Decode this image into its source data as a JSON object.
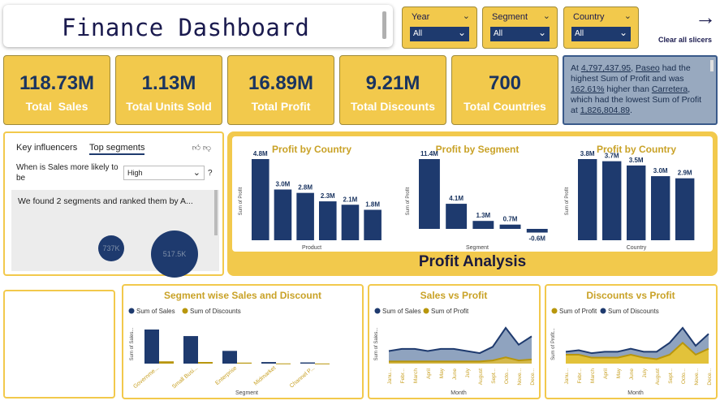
{
  "header": {
    "title": "Finance Dashboard"
  },
  "slicers": [
    {
      "label": "Year",
      "value": "All"
    },
    {
      "label": "Segment",
      "value": "All"
    },
    {
      "label": "Country",
      "value": "All"
    }
  ],
  "clear_slicers": {
    "label": "Clear all slicers",
    "icon": "arrow-right-icon"
  },
  "kpis": [
    {
      "value": "118.73M",
      "label": "Total  Sales"
    },
    {
      "value": "1.13M",
      "label": "Total Units Sold"
    },
    {
      "value": "16.89M",
      "label": "Total Profit"
    },
    {
      "value": "9.21M",
      "label": "Total Discounts"
    },
    {
      "value": "700",
      "label": "Total Countries"
    }
  ],
  "narrative": {
    "p1": "At ",
    "amount": "4,797,437.95",
    "p2": ", ",
    "top": "Paseo",
    "p3": " had the highest Sum of Profit and was ",
    "pct": "162.61%",
    "p4": " higher than ",
    "low": "Carretera",
    "p5": ", which had the lowest Sum of Profit at ",
    "low_amount": "1,826,804.89",
    "p6": "."
  },
  "key_influencers": {
    "tab1": "Key influencers",
    "tab2": "Top segments",
    "question": "When is Sales more likely to be",
    "dropdown": "High",
    "qmark": "?",
    "found": "We found 2 segments and ranked them by A...",
    "bubble1": "737K",
    "bubble2": "517.5K"
  },
  "profit_analysis": {
    "title": "Profit Analysis"
  },
  "colors": {
    "navy": "#1e3a6e",
    "gold": "#f2c94c",
    "gold_text": "#c9a227",
    "olive": "#b8960c",
    "area_blue": "#8fa3bf"
  },
  "chart_data": [
    {
      "type": "bar",
      "title": "Profit by Country",
      "xlabel": "Product",
      "ylabel": "Sum of Profit",
      "categories": [
        "",
        "",
        "",
        "",
        "",
        ""
      ],
      "values": [
        4.8,
        3.0,
        2.8,
        2.3,
        2.1,
        1.8
      ],
      "labels": [
        "4.8M",
        "3.0M",
        "2.8M",
        "2.3M",
        "2.1M",
        "1.8M"
      ]
    },
    {
      "type": "bar",
      "title": "Profit by Segment",
      "xlabel": "Segment",
      "ylabel": "Sum of Profit",
      "categories": [
        "",
        "",
        "",
        "",
        ""
      ],
      "values": [
        11.4,
        4.1,
        1.3,
        0.7,
        -0.6
      ],
      "labels": [
        "11.4M",
        "4.1M",
        "1.3M",
        "0.7M",
        "-0.6M"
      ]
    },
    {
      "type": "bar",
      "title": "Profit by Country",
      "xlabel": "Country",
      "ylabel": "Sum of Profit",
      "categories": [
        "",
        "",
        "",
        "",
        ""
      ],
      "values": [
        3.8,
        3.7,
        3.5,
        3.0,
        2.9
      ],
      "labels": [
        "3.8M",
        "3.7M",
        "3.5M",
        "3.0M",
        "2.9M"
      ]
    },
    {
      "type": "bar",
      "title": "Segment wise Sales and Discount",
      "xlabel": "Segment",
      "ylabel": "Sum of Sales...",
      "categories": [
        "Governme...",
        "Small Busi...",
        "Enterprise",
        "Midmarket",
        "Channel P..."
      ],
      "series": [
        {
          "name": "Sum of  Sales",
          "values": [
            52.5,
            42.4,
            19.6,
            2.4,
            1.8
          ]
        },
        {
          "name": "Sum of Discounts",
          "values": [
            3.5,
            2.5,
            1.5,
            0.3,
            0.2
          ]
        }
      ]
    },
    {
      "type": "area",
      "title": "Sales vs Profit",
      "xlabel": "Month",
      "ylabel": "Sum of Sales...",
      "categories": [
        "Janu...",
        "Febr...",
        "March",
        "April",
        "May",
        "June",
        "July",
        "August",
        "Sept...",
        "Octo...",
        "Nove...",
        "Dece..."
      ],
      "series": [
        {
          "name": "Sum of  Sales",
          "values": [
            6,
            7,
            7,
            6,
            7,
            7,
            6,
            5,
            8,
            17,
            9,
            13
          ]
        },
        {
          "name": "Sum of Profit",
          "values": [
            1,
            1,
            1,
            1,
            1,
            1,
            1,
            1,
            1.5,
            3,
            1.5,
            2
          ]
        }
      ]
    },
    {
      "type": "area",
      "title": "Discounts vs Profit",
      "xlabel": "Month",
      "ylabel": "Sum of Profit...",
      "categories": [
        "Janu...",
        "Febr...",
        "March",
        "April",
        "May",
        "June",
        "July",
        "August",
        "Sept...",
        "Octo...",
        "Nove...",
        "Dece..."
      ],
      "series": [
        {
          "name": "Sum of Profit",
          "values": [
            3,
            3,
            2,
            2,
            2,
            3,
            2,
            1.5,
            3,
            7,
            3,
            5
          ]
        },
        {
          "name": "Sum of Discounts",
          "values": [
            4,
            4.5,
            3.5,
            4,
            4,
            5,
            4,
            4,
            7,
            12,
            6,
            10
          ]
        }
      ]
    }
  ]
}
